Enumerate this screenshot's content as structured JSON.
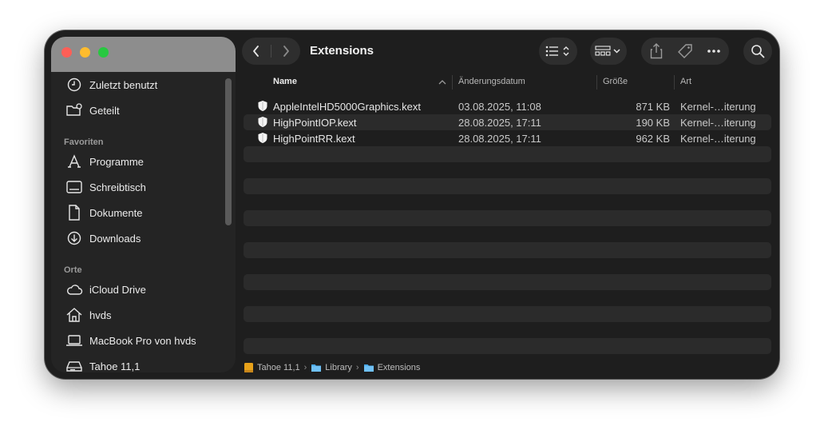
{
  "window": {
    "title": "Extensions",
    "colors": {
      "background": "#1e1e1e",
      "sidebar": "#242424",
      "close": "#fe5f57",
      "minimize": "#febc2e",
      "zoom": "#28c840"
    }
  },
  "sidebar": {
    "items_top": [
      {
        "label": "Zuletzt benutzt",
        "icon": "clock-icon"
      },
      {
        "label": "Geteilt",
        "icon": "shared-folder-icon"
      }
    ],
    "favorites_heading": "Favoriten",
    "favorites": [
      {
        "label": "Programme",
        "icon": "applications-icon"
      },
      {
        "label": "Schreibtisch",
        "icon": "desktop-icon"
      },
      {
        "label": "Dokumente",
        "icon": "document-icon"
      },
      {
        "label": "Downloads",
        "icon": "download-icon"
      }
    ],
    "locations_heading": "Orte",
    "locations": [
      {
        "label": "iCloud Drive",
        "icon": "cloud-icon"
      },
      {
        "label": "hvds",
        "icon": "home-icon"
      },
      {
        "label": "MacBook Pro von hvds",
        "icon": "laptop-icon"
      },
      {
        "label": "Tahoe 11,1",
        "icon": "disk-icon"
      }
    ]
  },
  "toolbar": {
    "back_icon": "chevron-left-icon",
    "forward_icon": "chevron-right-icon",
    "view_list_icon": "list-view-icon",
    "group_icon": "grid-group-icon",
    "share_icon": "share-icon",
    "tag_icon": "tag-icon",
    "more_icon": "ellipsis-icon",
    "search_icon": "search-icon"
  },
  "columns": {
    "name": "Name",
    "date": "Änderungsdatum",
    "size": "Größe",
    "kind": "Art"
  },
  "files": [
    {
      "name": "AppleIntelHD5000Graphics.kext",
      "date": "03.08.2025, 11:08",
      "size": "871 KB",
      "kind": "Kernel-…iterung"
    },
    {
      "name": "HighPointIOP.kext",
      "date": "28.08.2025, 17:11",
      "size": "190 KB",
      "kind": "Kernel-…iterung"
    },
    {
      "name": "HighPointRR.kext",
      "date": "28.08.2025, 17:11",
      "size": "962 KB",
      "kind": "Kernel-…iterung"
    }
  ],
  "pathbar": [
    {
      "label": "Tahoe 11,1",
      "icon": "disk-icon"
    },
    {
      "label": "Library",
      "icon": "folder-icon"
    },
    {
      "label": "Extensions",
      "icon": "folder-icon"
    }
  ],
  "separator": "›"
}
